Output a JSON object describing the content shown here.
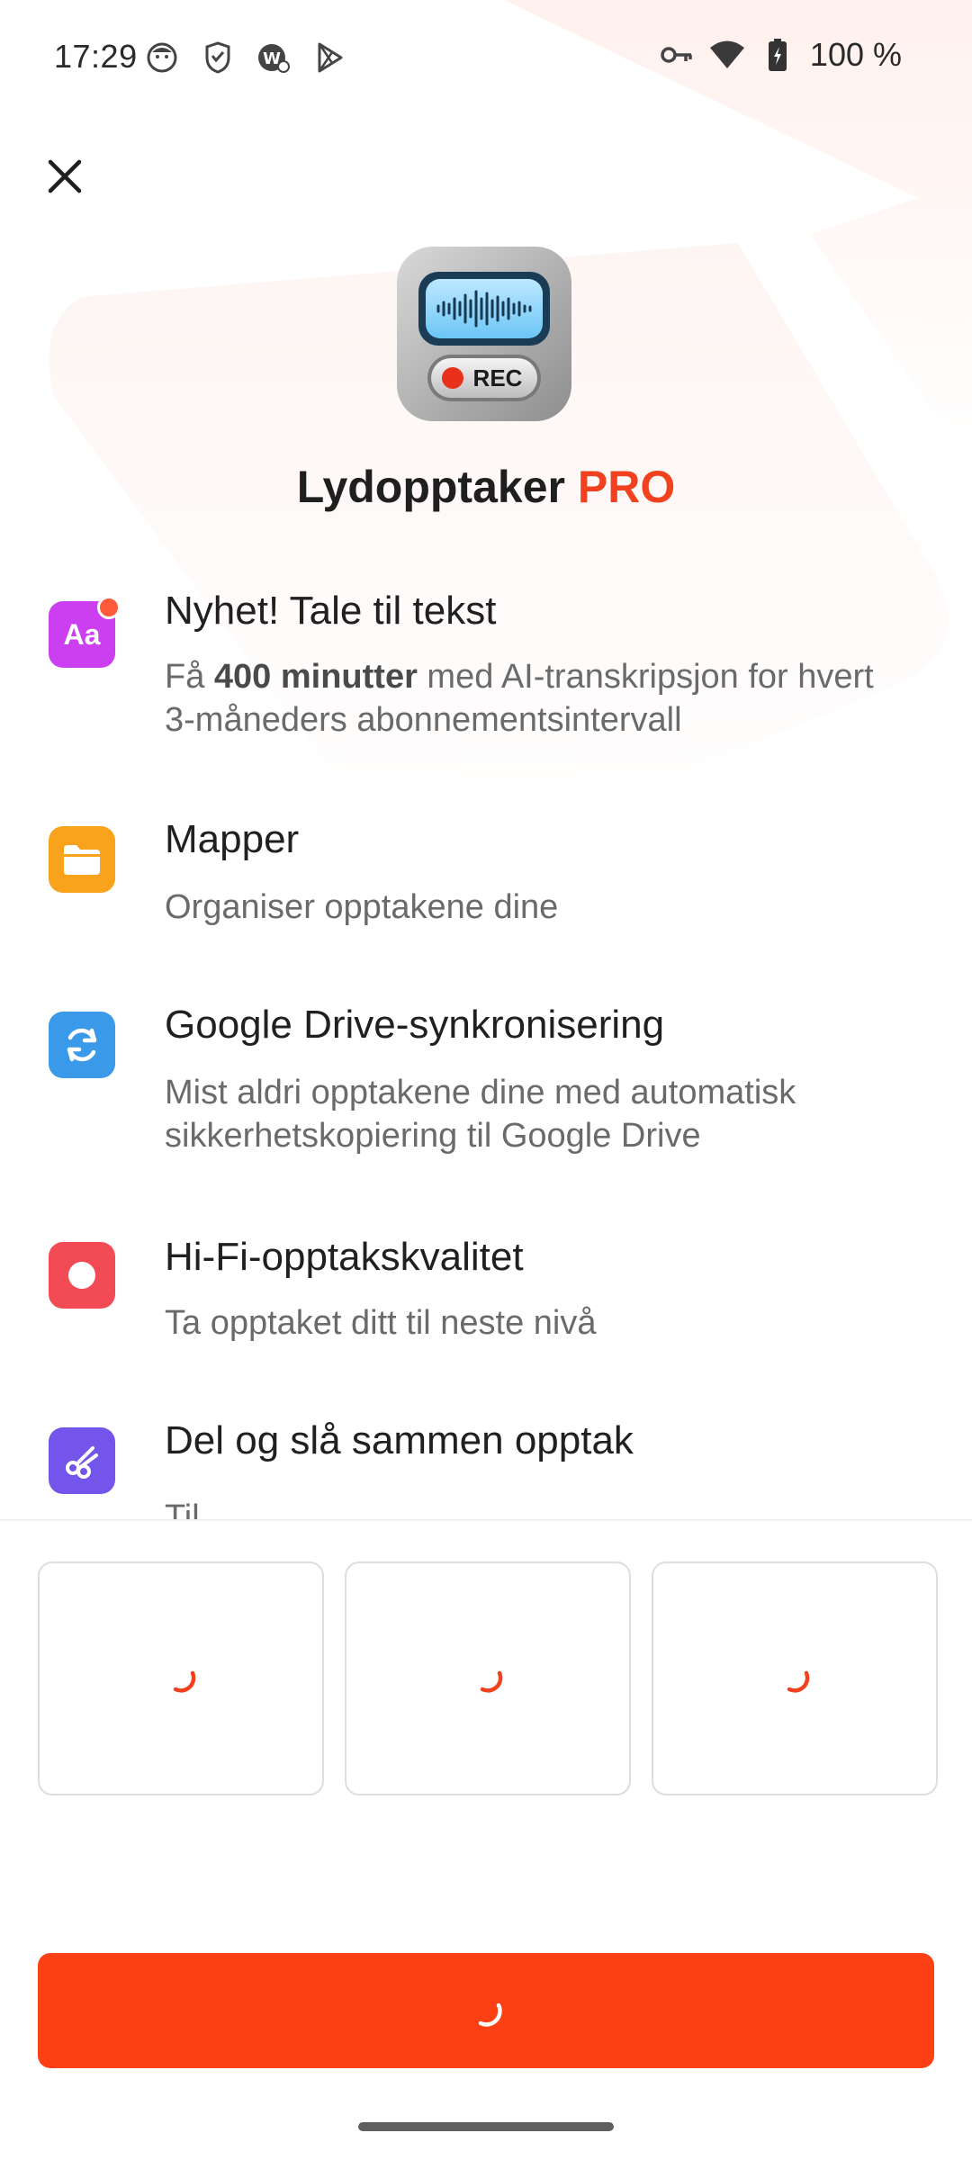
{
  "status_bar": {
    "time": "17:29",
    "battery_text": "100 %"
  },
  "header": {
    "app_name": "Lydopptaker",
    "pro_label": "PRO",
    "icon_rec_label": "REC"
  },
  "features": [
    {
      "title": "Nyhet! Tale til tekst",
      "desc_before": "Få ",
      "desc_bold": "400 minutter",
      "desc_after": " med AI-transkripsjon for hvert 3-måneders abonnementsintervall",
      "icon": "text-aa-icon",
      "color": "#cc3ff0"
    },
    {
      "title": "Mapper",
      "desc": "Organiser opptakene dine",
      "icon": "folder-icon",
      "color": "#f9a21c"
    },
    {
      "title": "Google Drive-synkronisering",
      "desc": "Mist aldri opptakene dine med automatisk sikkerhetskopiering til Google Drive",
      "icon": "sync-icon",
      "color": "#3a99e8"
    },
    {
      "title": "Hi-Fi-opptakskvalitet",
      "desc": "Ta opptaket ditt til neste nivå",
      "icon": "record-icon",
      "color": "#f34b55"
    },
    {
      "title": "Del og slå sammen opptak",
      "desc": "Til",
      "icon": "scissors-icon",
      "color": "#7455ec"
    }
  ],
  "accent_color": "#fd3f14"
}
